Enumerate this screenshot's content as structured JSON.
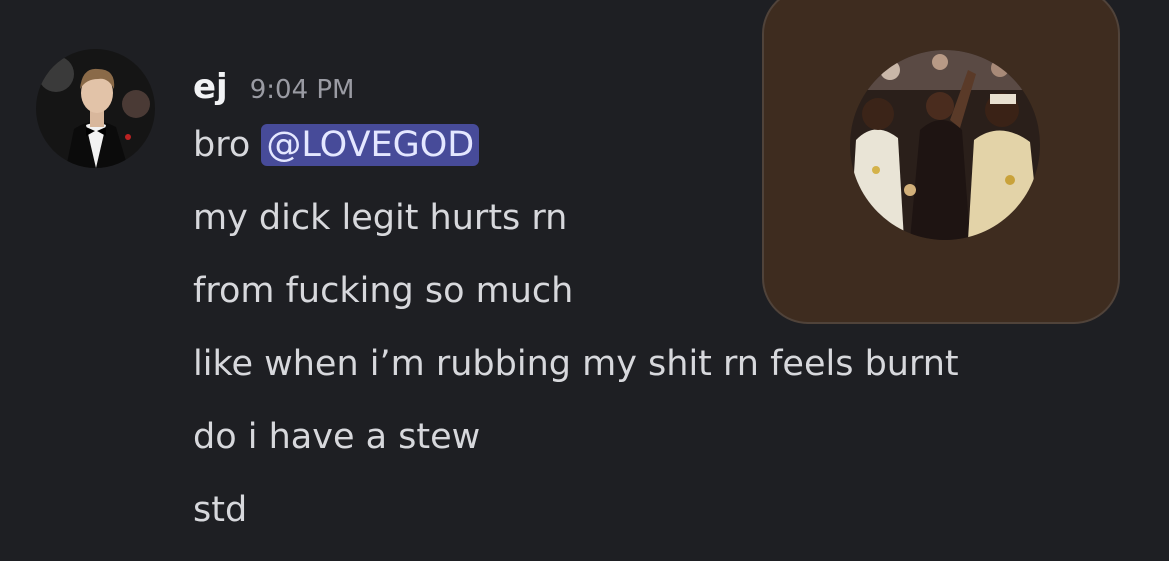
{
  "message": {
    "username": "ej",
    "timestamp": "9:04 PM",
    "first_line_prefix": "bro ",
    "mention": "@LOVEGOD",
    "lines": [
      "my dick legit hurts rn",
      "from fucking so much",
      "like when i’m rubbing my shit rn feels burnt",
      "do i have a stew",
      "std"
    ]
  },
  "colors": {
    "background": "#1e1f23",
    "mention_bg": "#474b99",
    "popup_bg": "#3e2c1f"
  }
}
